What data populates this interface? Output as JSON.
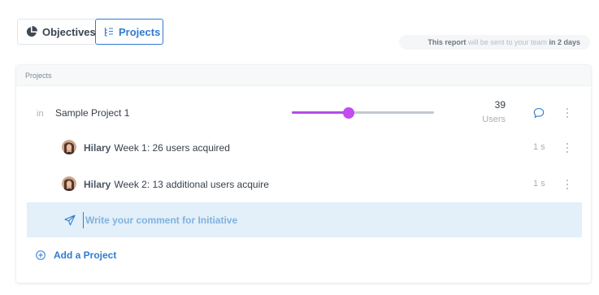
{
  "tabs": [
    {
      "label": "Objectives",
      "icon": "pie-chart-icon",
      "active": false
    },
    {
      "label": "Projects",
      "icon": "project-list-icon",
      "active": true
    }
  ],
  "report_note": {
    "prefix": "This report",
    "middle": " will be sent to your team ",
    "suffix": "in 2 days"
  },
  "card": {
    "header": "Projects",
    "project": {
      "in_label": "in",
      "name": "Sample Project 1",
      "progress": 0.4,
      "metric_value": "39",
      "metric_unit": "Users",
      "accent_color": "#c24cf0"
    },
    "updates": [
      {
        "author": "Hilary",
        "text": "Week 1: 26 users acquired",
        "time": "1 s"
      },
      {
        "author": "Hilary",
        "text": "Week 2: 13 additional users acquire",
        "time": "1 s"
      }
    ],
    "comment_placeholder": "Write your comment for Initiative",
    "add_project_label": "Add a Project"
  },
  "colors": {
    "primary": "#2f7bd1",
    "slider_fill": "#b24ee8",
    "comment_bg": "#e3eff9"
  }
}
